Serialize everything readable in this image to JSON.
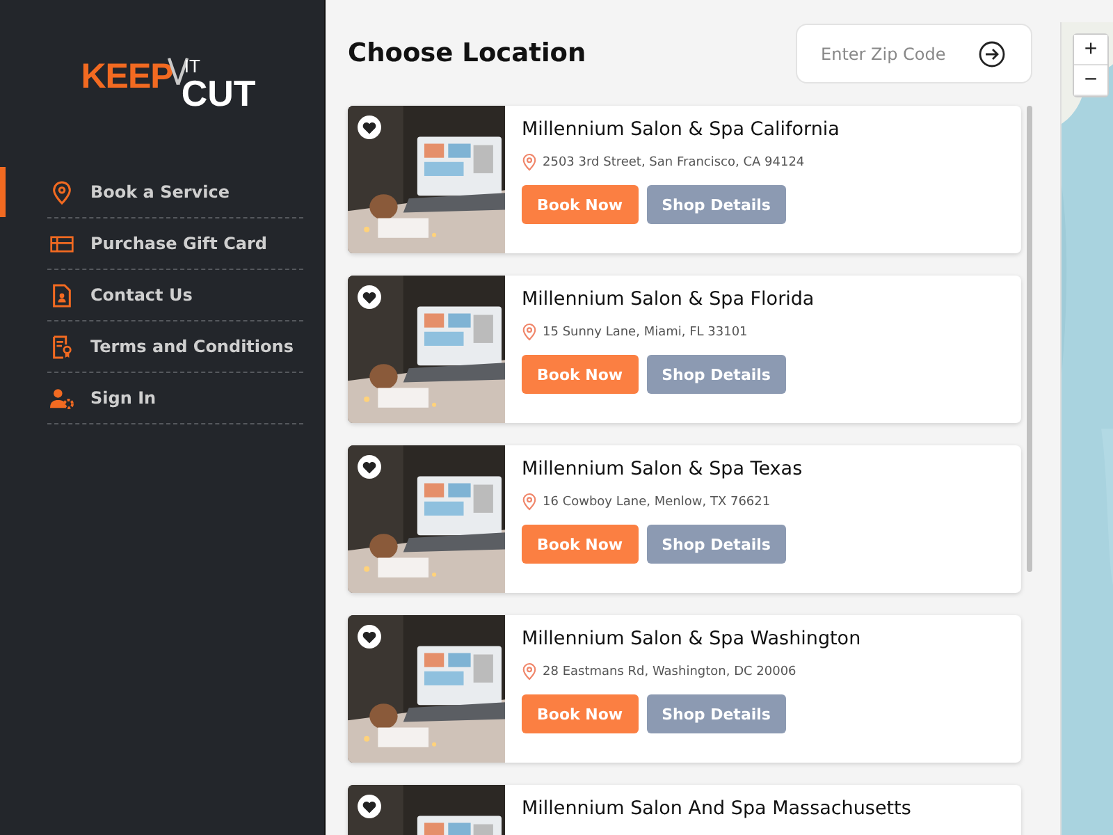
{
  "logo": {
    "word_1": "KEEP",
    "word_2": "IT",
    "word_3": "CUT"
  },
  "nav": [
    {
      "label": "Book a Service",
      "selected": true
    },
    {
      "label": "Purchase Gift Card",
      "selected": false
    },
    {
      "label": "Contact Us",
      "selected": false
    },
    {
      "label": "Terms and Conditions",
      "selected": false
    },
    {
      "label": "Sign In",
      "selected": false
    }
  ],
  "title": "Choose Location",
  "search": {
    "placeholder": "Enter Zip Code"
  },
  "locations": [
    {
      "name": "Millennium Salon & Spa California",
      "address": "2503 3rd Street, San Francisco, CA 94124",
      "buttons": [
        "Book Now",
        "Shop Details"
      ]
    },
    {
      "name": "Millennium Salon & Spa Florida",
      "address": "15 Sunny Lane, Miami, FL 33101",
      "buttons": [
        "Book Now",
        "Shop Details"
      ]
    },
    {
      "name": "Millennium Salon & Spa Texas",
      "address": "16 Cowboy Lane, Menlow, TX 76621",
      "buttons": [
        "Book Now",
        "Shop Details"
      ]
    },
    {
      "name": "Millennium Salon & Spa Washington",
      "address": "28 Eastmans Rd, Washington, DC 20006",
      "buttons": [
        "Book Now",
        "Shop Details"
      ]
    },
    {
      "name": "Millennium Salon And Spa Massachusetts"
    }
  ],
  "map": {
    "zoom_in": "+",
    "zoom_out": "−"
  }
}
